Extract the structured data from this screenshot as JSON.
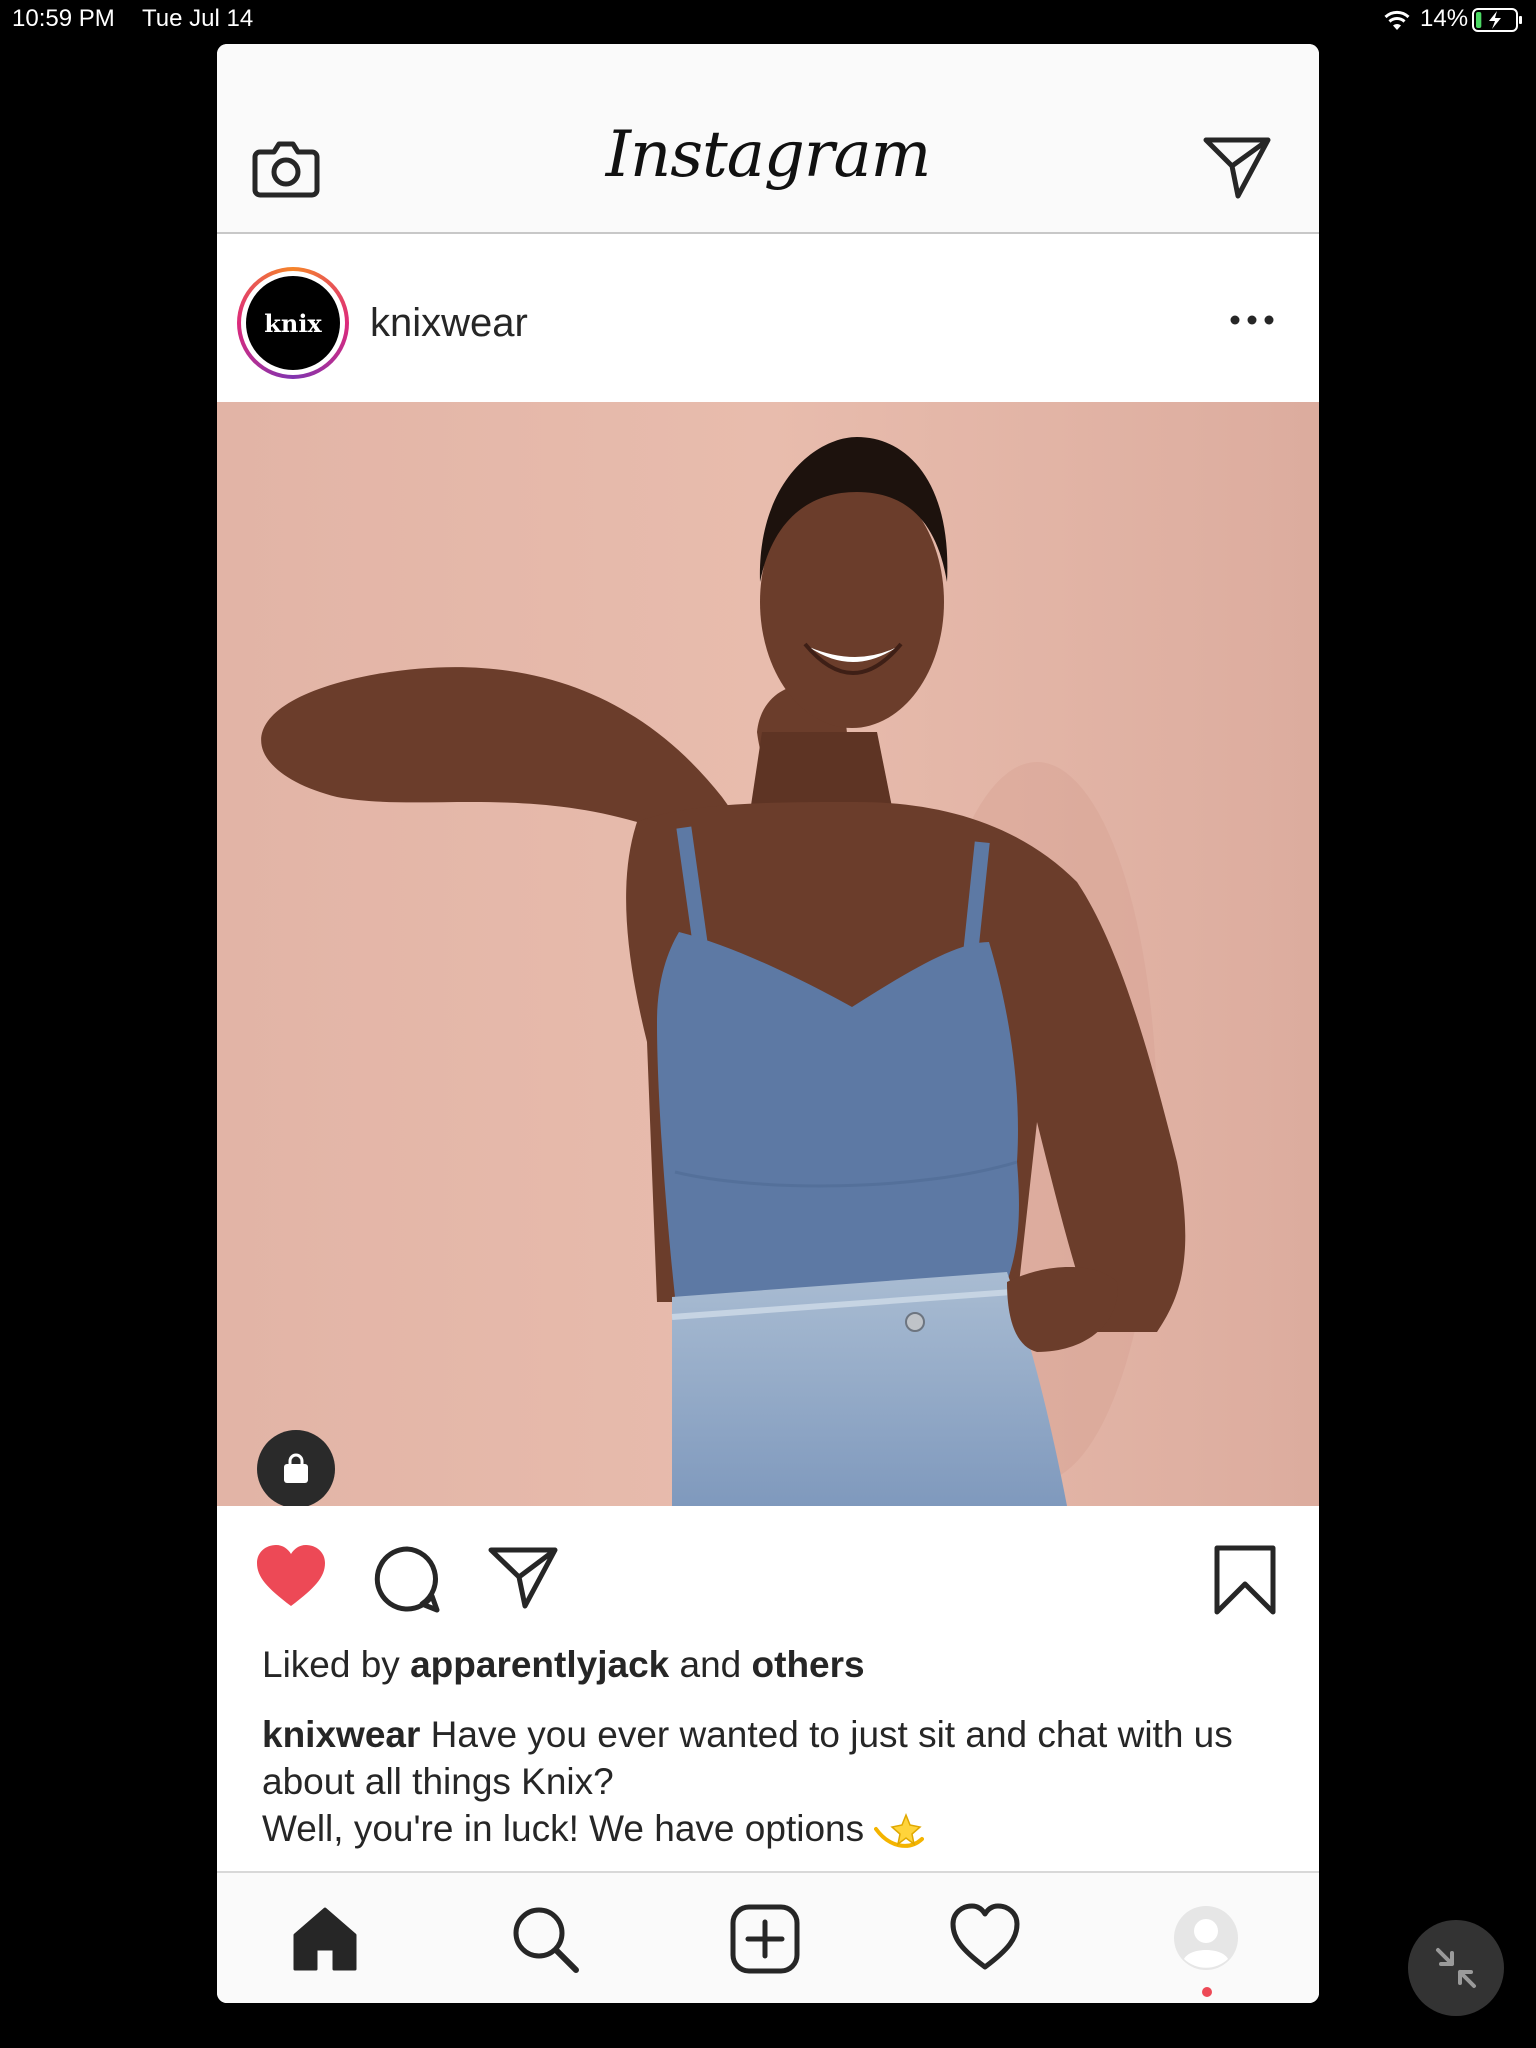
{
  "status_bar": {
    "time": "10:59 PM",
    "date": "Tue Jul 14",
    "battery_percent": "14%",
    "battery_level": 0.14,
    "charging": true
  },
  "header": {
    "logo_text": "Instagram",
    "camera_icon": "camera-icon",
    "direct_icon": "direct-message-icon"
  },
  "post": {
    "username": "knixwear",
    "avatar_text": "knix",
    "image_alt": "Smiling woman wearing a blue bodysuit and light denim jeans against a pink wall",
    "colors": {
      "background": "#e4b4a6",
      "garment": "#5d79a4",
      "like_red": "#ed4956"
    },
    "liked_by_prefix": "Liked by",
    "liked_by_user": "apparentlyjack",
    "liked_by_and": "and",
    "liked_by_others": "others",
    "caption_user": "knixwear",
    "caption_line1": "Have you ever wanted to just sit and chat with us about all things Knix?",
    "caption_line2": "Well, you're in luck! We have options",
    "liked": true
  },
  "tabbar": {
    "items": [
      "home-icon",
      "search-icon",
      "add-post-icon",
      "activity-heart-icon",
      "profile-icon"
    ],
    "active": "home"
  }
}
